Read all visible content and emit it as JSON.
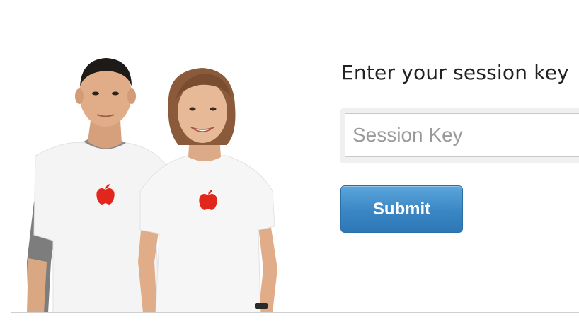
{
  "login": {
    "heading": "Enter your session key",
    "session_input_placeholder": "Session Key",
    "session_input_value": "",
    "submit_label": "Submit"
  },
  "hero": {
    "image_subject": "two-staff-in-white-apple-logo-tshirts",
    "logo_color": "#e1261c"
  },
  "colors": {
    "button": "#3a86c4",
    "text": "#222222",
    "placeholder": "#9a9a9a"
  }
}
